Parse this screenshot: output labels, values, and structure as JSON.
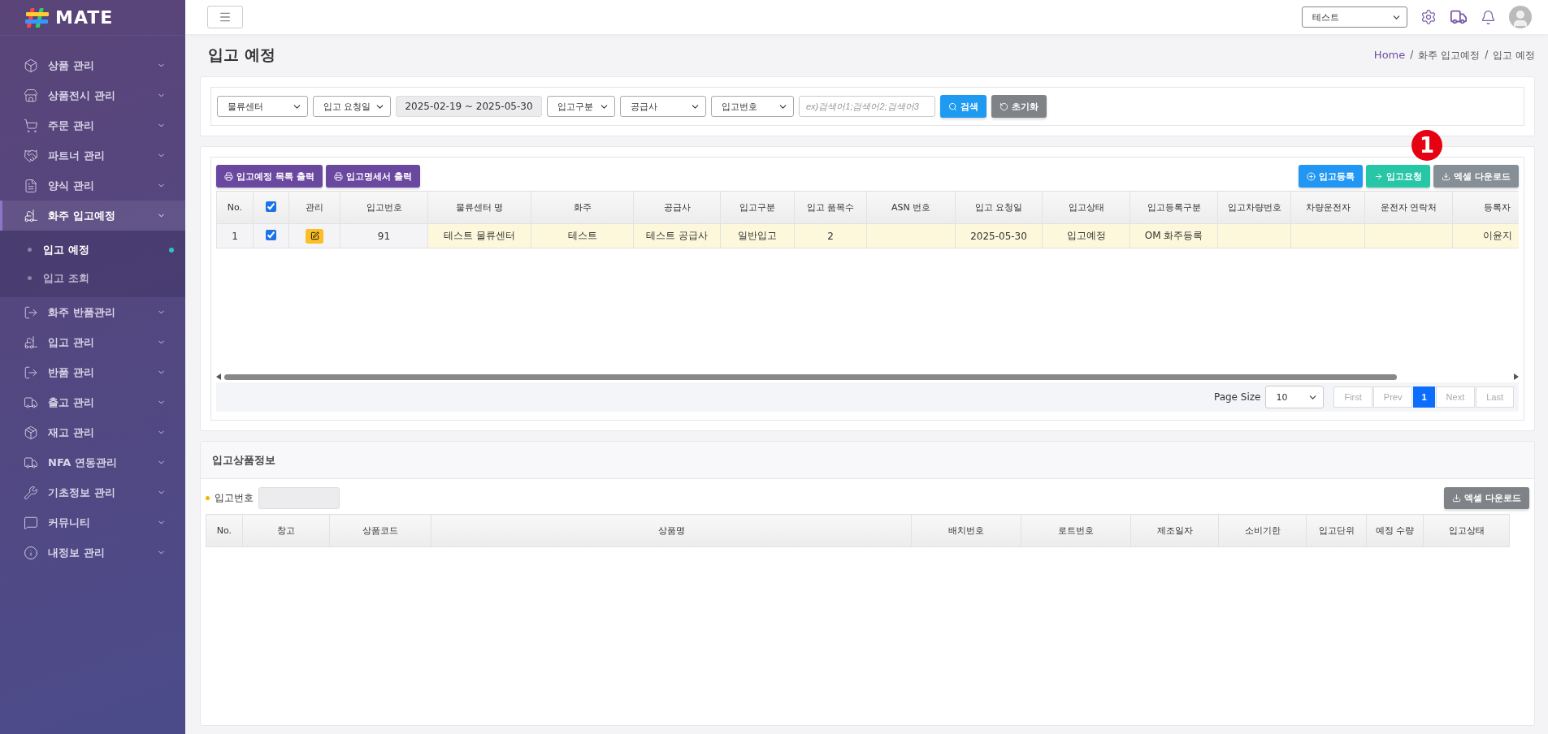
{
  "logo": {
    "text": "MATE"
  },
  "sidebar": {
    "items": [
      {
        "label": "상품 관리",
        "expanded": false
      },
      {
        "label": "상품전시 관리",
        "expanded": false
      },
      {
        "label": "주문 관리",
        "expanded": false
      },
      {
        "label": "파트너 관리",
        "expanded": false
      },
      {
        "label": "양식 관리",
        "expanded": false
      },
      {
        "label": "화주 입고예정",
        "expanded": true,
        "children": [
          {
            "label": "입고 예정",
            "selected": true
          },
          {
            "label": "입고 조회",
            "selected": false
          }
        ]
      },
      {
        "label": "화주 반품관리",
        "expanded": false
      },
      {
        "label": "입고 관리",
        "expanded": false
      },
      {
        "label": "반품 관리",
        "expanded": false
      },
      {
        "label": "출고 관리",
        "expanded": false
      },
      {
        "label": "재고 관리",
        "expanded": false
      },
      {
        "label": "NFA 연동관리",
        "expanded": false
      },
      {
        "label": "기초정보 관리",
        "expanded": false
      },
      {
        "label": "커뮤니티",
        "expanded": false
      },
      {
        "label": "내정보 관리",
        "expanded": false
      }
    ]
  },
  "topbar": {
    "account_select": "테스트"
  },
  "page": {
    "title": "입고 예정",
    "breadcrumb": [
      "Home",
      "화주 입고예정",
      "입고 예정"
    ],
    "breadcrumb_separator": "/"
  },
  "filters": {
    "center": "물류센터",
    "date_type": "입고 요청일",
    "date_range": "2025-02-19 ~ 2025-05-30",
    "inbound_type": "입고구분",
    "supplier": "공급사",
    "number_type": "입고번호",
    "keyword_placeholder": "ex)검색어1;검색어2;검색어3",
    "search_button": "검색",
    "reset_button": "초기화"
  },
  "list": {
    "left_buttons": [
      "입고예정 목록 출력",
      "입고명세서 출력"
    ],
    "right_buttons": [
      {
        "label": "입고등록",
        "kind": "register"
      },
      {
        "label": "입고요청",
        "kind": "request"
      },
      {
        "label": "엑셀 다운로드",
        "kind": "excel"
      }
    ],
    "marker": "1",
    "columns": [
      {
        "label": "No.",
        "frozen": true
      },
      {
        "kind": "check",
        "frozen": true
      },
      {
        "label": "관리",
        "frozen": true
      },
      {
        "label": "입고번호",
        "frozen": true
      },
      {
        "label": "물류센터 명",
        "frozen": false
      },
      {
        "label": "화주",
        "frozen": false
      },
      {
        "label": "공급사",
        "frozen": false
      },
      {
        "label": "입고구분",
        "frozen": false
      },
      {
        "label": "입고 품목수",
        "frozen": false
      },
      {
        "label": "ASN 번호",
        "frozen": false
      },
      {
        "label": "입고 요청일",
        "frozen": false
      },
      {
        "label": "입고상태",
        "frozen": false
      },
      {
        "label": "입고등록구분",
        "frozen": false
      },
      {
        "label": "입고차량번호",
        "frozen": false
      },
      {
        "label": "차량운전자",
        "frozen": false
      },
      {
        "label": "운전자 연락처",
        "frozen": false
      },
      {
        "label": "등록자",
        "frozen": false
      }
    ],
    "header_checked": true,
    "rows": [
      {
        "checked": true,
        "cells": [
          "1",
          null,
          null,
          "91",
          "테스트 물류센터",
          "테스트",
          "테스트 공급사",
          "일반입고",
          "2",
          null,
          "2025-05-30",
          "입고예정",
          "OM 화주등록",
          null,
          null,
          null,
          "이윤지"
        ]
      }
    ],
    "page_size_label": "Page Size",
    "page_size": "10",
    "pages": [
      {
        "label": "First",
        "selected": false
      },
      {
        "label": "Prev",
        "selected": false
      },
      {
        "label": "1",
        "selected": true
      },
      {
        "label": "Next",
        "selected": false
      },
      {
        "label": "Last",
        "selected": false
      }
    ]
  },
  "detail": {
    "title": "입고상품정보",
    "field_label": "입고번호",
    "excel_button": "엑셀 다운로드",
    "columns": [
      "No.",
      "창고",
      "상품코드",
      "상품명",
      "배치번호",
      "로트번호",
      "제조일자",
      "소비기한",
      "입고단위",
      "예정 수량",
      "입고상태"
    ]
  }
}
